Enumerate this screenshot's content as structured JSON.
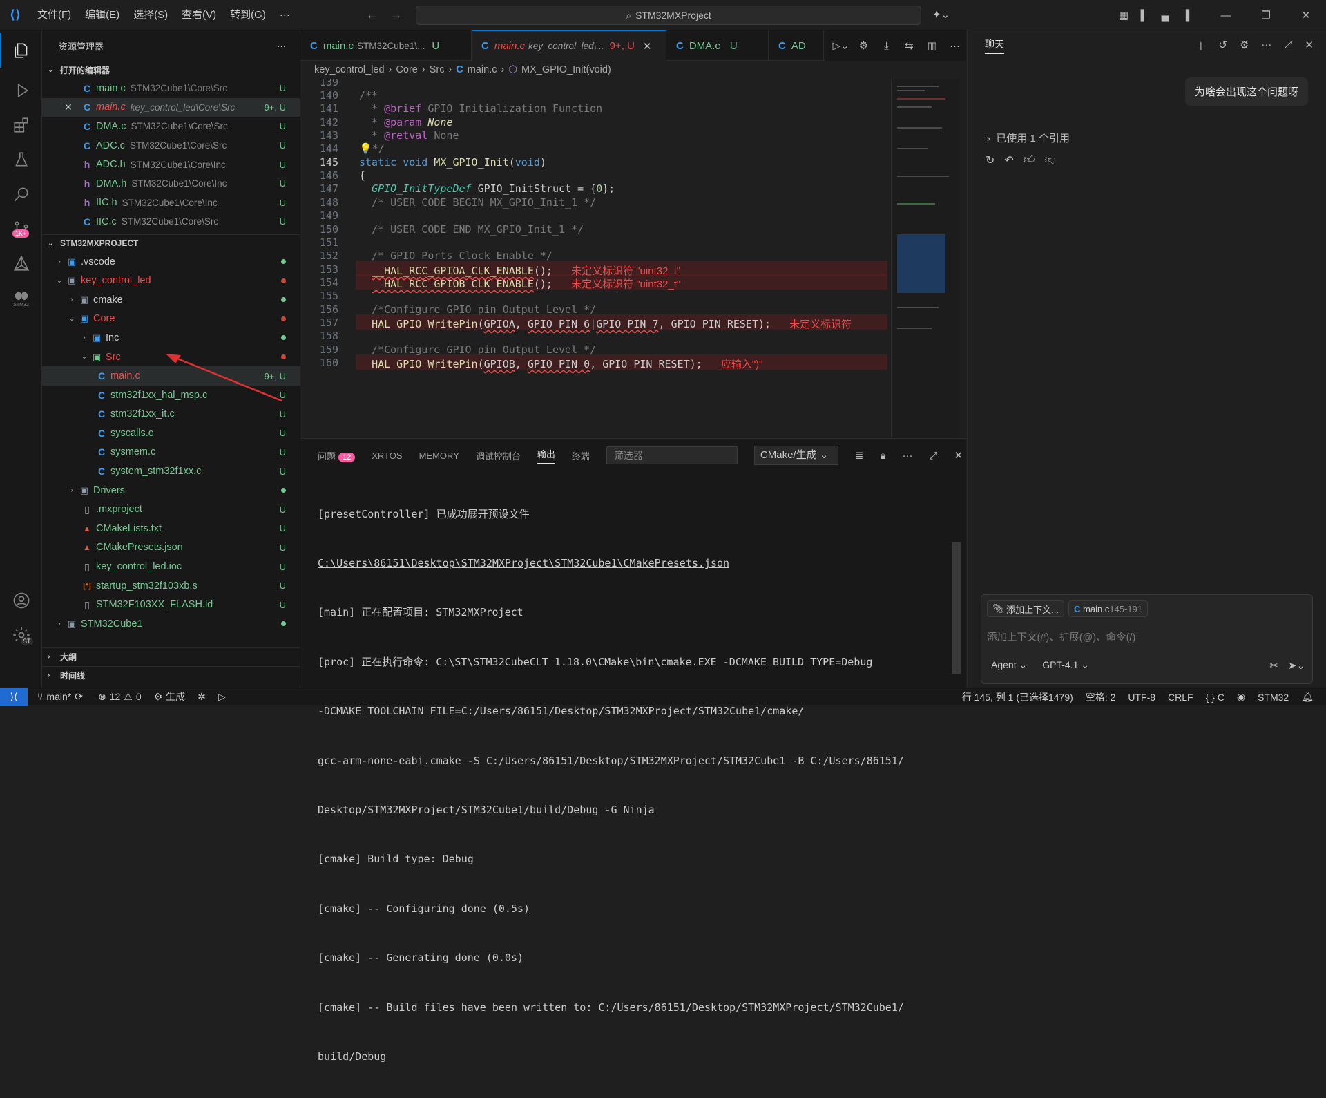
{
  "title_bar": {
    "menu": [
      "文件(F)",
      "编辑(E)",
      "选择(S)",
      "查看(V)",
      "转到(G)",
      "···"
    ],
    "search_text": "STM32MXProject"
  },
  "activity_bar": {
    "scm_badge": "1K+",
    "stm32_label": "STM32",
    "st_label": "ST"
  },
  "explorer": {
    "header": "资源管理器",
    "open_editors_title": "打开的编辑器",
    "open_editors": [
      {
        "name": "main.c",
        "path": "STM32Cube1\\Core\\Src",
        "status": "U",
        "icon": "C"
      },
      {
        "name": "main.c",
        "path": "key_control_led\\Core\\Src",
        "status": "9+, U",
        "icon": "C",
        "close": "✕"
      },
      {
        "name": "DMA.c",
        "path": "STM32Cube1\\Core\\Src",
        "status": "U",
        "icon": "C"
      },
      {
        "name": "ADC.c",
        "path": "STM32Cube1\\Core\\Src",
        "status": "U",
        "icon": "C"
      },
      {
        "name": "ADC.h",
        "path": "STM32Cube1\\Core\\Inc",
        "status": "U",
        "icon": "h"
      },
      {
        "name": "DMA.h",
        "path": "STM32Cube1\\Core\\Inc",
        "status": "U",
        "icon": "h"
      },
      {
        "name": "IIC.h",
        "path": "STM32Cube1\\Core\\Inc",
        "status": "U",
        "icon": "h"
      },
      {
        "name": "IIC.c",
        "path": "STM32Cube1\\Core\\Src",
        "status": "U",
        "icon": "C"
      }
    ],
    "project_title": "STM32MXPROJECT",
    "tree": [
      {
        "name": ".vscode",
        "status": "",
        "icon": "▣"
      },
      {
        "name": "key_control_led",
        "status": "",
        "icon": "▣"
      },
      {
        "name": "cmake",
        "status": "",
        "icon": "▣"
      },
      {
        "name": "Core",
        "status": "",
        "icon": "▣"
      },
      {
        "name": "Inc",
        "status": "",
        "icon": "▣"
      },
      {
        "name": "Src",
        "status": "",
        "icon": "▣"
      },
      {
        "name": "main.c",
        "status": "9+, U",
        "icon": "C"
      },
      {
        "name": "stm32f1xx_hal_msp.c",
        "status": "U",
        "icon": "C"
      },
      {
        "name": "stm32f1xx_it.c",
        "status": "U",
        "icon": "C"
      },
      {
        "name": "syscalls.c",
        "status": "U",
        "icon": "C"
      },
      {
        "name": "sysmem.c",
        "status": "U",
        "icon": "C"
      },
      {
        "name": "system_stm32f1xx.c",
        "status": "U",
        "icon": "C"
      },
      {
        "name": "Drivers",
        "status": "",
        "icon": "▣"
      },
      {
        "name": ".mxproject",
        "status": "U",
        "icon": "▯"
      },
      {
        "name": "CMakeLists.txt",
        "status": "U",
        "icon": "▲"
      },
      {
        "name": "CMakePresets.json",
        "status": "U",
        "icon": "▲"
      },
      {
        "name": "key_control_led.ioc",
        "status": "U",
        "icon": "▯"
      },
      {
        "name": "startup_stm32f103xb.s",
        "status": "U",
        "icon": "[*]"
      },
      {
        "name": "STM32F103XX_FLASH.ld",
        "status": "U",
        "icon": "▯"
      },
      {
        "name": "STM32Cube1",
        "status": "",
        "icon": "▣"
      }
    ],
    "outline_title": "大纲",
    "timeline_title": "时间线"
  },
  "editor": {
    "tabs": [
      {
        "name": "main.c",
        "path": "STM32Cube1\\...",
        "status": "U"
      },
      {
        "name": "main.c",
        "path": "key_control_led\\...",
        "status": "9+, U",
        "close": "✕"
      },
      {
        "name": "DMA.c",
        "path": "",
        "status": "U"
      },
      {
        "name": "AD",
        "path": "",
        "status": ""
      }
    ],
    "breadcrumb": [
      "key_control_led",
      "Core",
      "Src",
      "main.c",
      "MX_GPIO_Init(void)"
    ],
    "line_numbers": [
      "139",
      "140",
      "141",
      "142",
      "143",
      "144",
      "145",
      "146",
      "147",
      "148",
      "149",
      "150",
      "151",
      "152",
      "153",
      "154",
      "155",
      "156",
      "157",
      "158",
      "159",
      "160"
    ],
    "error_153": "未定义标识符 \"uint32_t\"",
    "error_154": "未定义标识符 \"uint32_t\"",
    "error_157": "未定义标识符",
    "error_160": "应输入\")\""
  },
  "panel": {
    "tabs": [
      "问题",
      "XRTOS",
      "MEMORY",
      "调试控制台",
      "输出",
      "终端"
    ],
    "problems_count": "12",
    "filter_placeholder": "筛选器",
    "output_channel": "CMake/生成",
    "output_lines": [
      "[presetController] 已成功展开预设文件",
      "C:\\Users\\86151\\Desktop\\STM32MXProject\\STM32Cube1\\CMakePresets.json",
      "[main] 正在配置项目: STM32MXProject",
      "[proc] 正在执行命令: C:\\ST\\STM32CubeCLT_1.18.0\\CMake\\bin\\cmake.EXE -DCMAKE_BUILD_TYPE=Debug",
      "-DCMAKE_TOOLCHAIN_FILE=C:/Users/86151/Desktop/STM32MXProject/STM32Cube1/cmake/",
      "gcc-arm-none-eabi.cmake -S C:/Users/86151/Desktop/STM32MXProject/STM32Cube1 -B C:/Users/86151/",
      "Desktop/STM32MXProject/STM32Cube1/build/Debug -G Ninja",
      "[cmake] Build type: Debug",
      "[cmake] -- Configuring done (0.5s)",
      "[cmake] -- Generating done (0.0s)",
      "[cmake] -- Build files have been written to: C:/Users/86151/Desktop/STM32MXProject/STM32Cube1/",
      "build/Debug"
    ]
  },
  "chat": {
    "title": "聊天",
    "user_message": "为啥会出现这个问题呀",
    "references": "已使用 1 个引用",
    "add_context": "添加上下文...",
    "context_file": "main.c",
    "context_range": "145-191",
    "input_placeholder": "添加上下文(#)、扩展(@)、命令(/)",
    "mode": "Agent",
    "model": "GPT-4.1"
  },
  "status_bar": {
    "branch": "main*",
    "errors": "12",
    "warnings": "0",
    "build": "生成",
    "position": "行 145, 列 1 (已选择1479)",
    "spaces": "空格: 2",
    "encoding": "UTF-8",
    "eol": "CRLF",
    "language": "C",
    "platform": "STM32"
  }
}
